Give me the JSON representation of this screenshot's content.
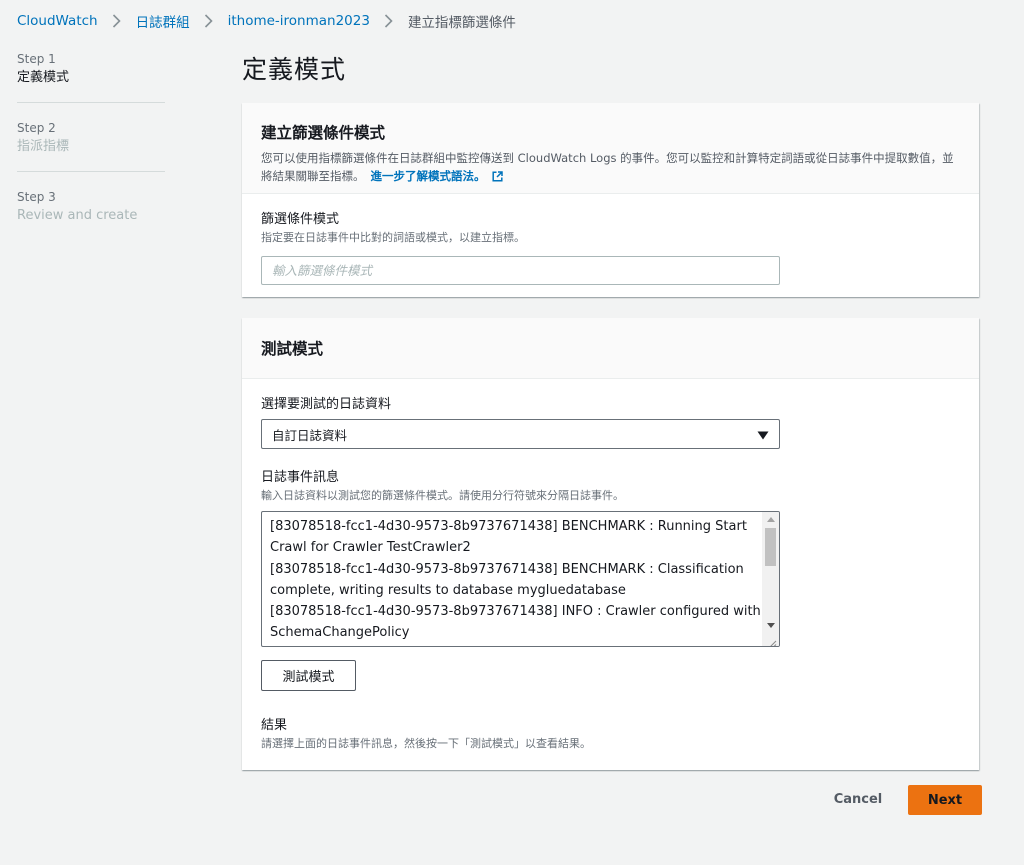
{
  "breadcrumb": {
    "items": [
      "CloudWatch",
      "日誌群組",
      "ithome-ironman2023"
    ],
    "current": "建立指標篩選條件"
  },
  "steps": [
    {
      "number": "Step 1",
      "title": "定義模式",
      "state": "active"
    },
    {
      "number": "Step 2",
      "title": "指派指標",
      "state": "disabled"
    },
    {
      "number": "Step 3",
      "title": "Review and create",
      "state": "disabled"
    }
  ],
  "page_title": "定義模式",
  "pattern_panel": {
    "heading": "建立篩選條件模式",
    "description": "您可以使用指標篩選條件在日誌群組中監控傳送到 CloudWatch Logs 的事件。您可以監控和計算特定詞語或從日誌事件中提取數值，並將結果關聯至指標。",
    "learn_more": "進一步了解模式語法。",
    "field_label": "篩選條件模式",
    "field_description": "指定要在日誌事件中比對的詞語或模式，以建立指標。",
    "field_placeholder": "輸入篩選條件模式"
  },
  "test_panel": {
    "heading": "測試模式",
    "select_label": "選擇要測試的日誌資料",
    "select_value": "自訂日誌資料",
    "log_label": "日誌事件訊息",
    "log_description": "輸入日誌資料以測試您的篩選條件模式。請使用分行符號來分隔日誌事件。",
    "log_lines": [
      "[83078518-fcc1-4d30-9573-8b9737671438] BENCHMARK : Running Start",
      "Crawl for Crawler TestCrawler2",
      "[83078518-fcc1-4d30-9573-8b9737671438] BENCHMARK : Classification",
      "complete, writing results to database mygluedatabase",
      "[83078518-fcc1-4d30-9573-8b9737671438] INFO : Crawler configured with",
      "SchemaChangePolicy"
    ],
    "test_button": "測試模式",
    "result_label": "結果",
    "result_description": "請選擇上面的日誌事件訊息，然後按一下「測試模式」以查看結果。"
  },
  "footer": {
    "cancel": "Cancel",
    "next": "Next"
  },
  "colors": {
    "link": "#0073bb",
    "primary_button": "#ec7211",
    "background": "#f2f3f3"
  }
}
